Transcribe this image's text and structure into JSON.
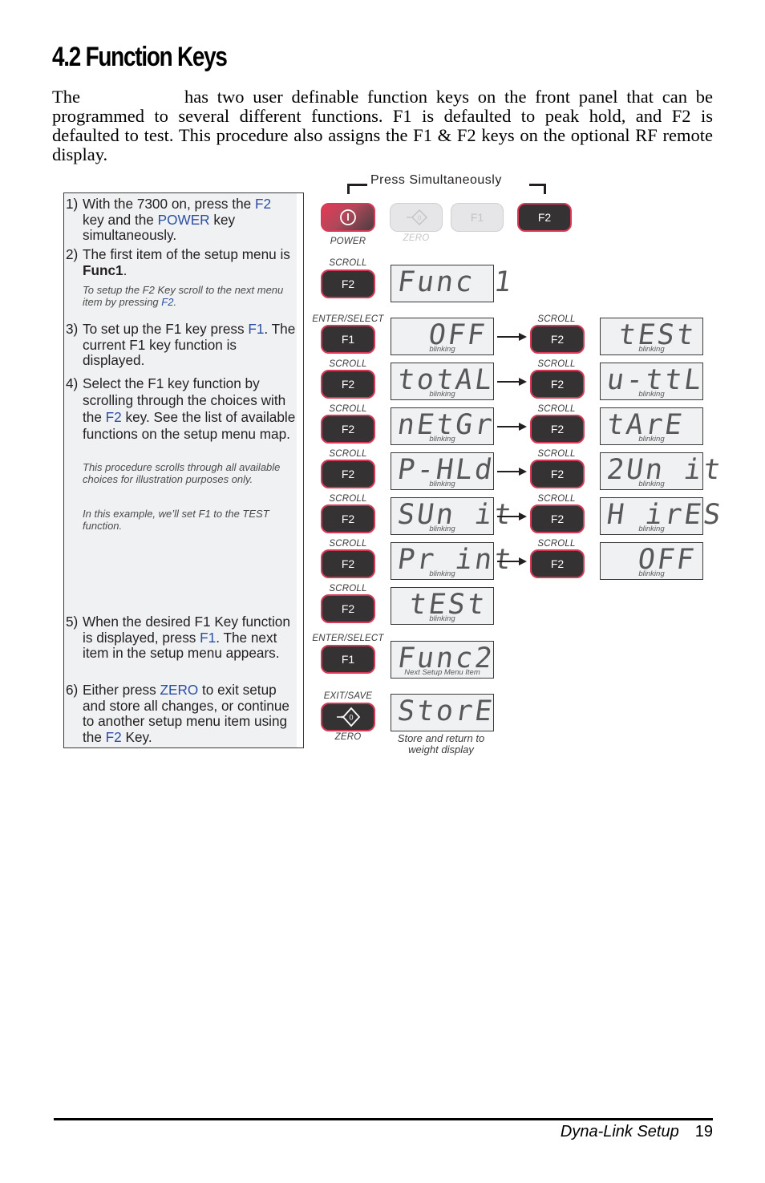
{
  "heading": "4.2   Function Keys",
  "intro": {
    "start": "The",
    "rest": "has two user definable function keys on the front panel that can be programmed to several different functions. F1 is defaulted to peak hold, and F2 is defaulted to test. This procedure also assigns the F1 & F2 keys on the optional RF remote display."
  },
  "steps": [
    {
      "num": "1)",
      "parts": [
        "With the 7300 on, press the ",
        "F2",
        " key and the ",
        "POWER",
        " key simultaneously."
      ]
    },
    {
      "num": "2)",
      "parts": [
        "The first item of the setup menu is ",
        "Func1",
        "."
      ]
    },
    {
      "num": "3)",
      "parts": [
        "To set up the F1 key press ",
        "F1",
        ". The current F1 key function is displayed."
      ]
    },
    {
      "num": "4)",
      "parts": [
        "Select the F1 key function by scrolling through the choices with the ",
        "F2",
        " key. See the list of available functions on the setup menu map."
      ]
    },
    {
      "num": "5)",
      "parts": [
        "When the desired F1 Key function is displayed, press ",
        "F1",
        ". The next item in the setup menu appears."
      ]
    },
    {
      "num": "6)",
      "parts": [
        "Either press ",
        "ZERO",
        " to exit setup and store all changes, or continue to another setup menu item using the ",
        "F2",
        " Key."
      ]
    }
  ],
  "notes": {
    "f2_setup": [
      "To setup the F2 Key scroll to the next menu item by pressing ",
      "F2",
      "."
    ],
    "illustration": "This procedure scrolls through all available choices for illustration purposes only.",
    "example": "In this example, we’ll set F1 to the TEST function."
  },
  "diagram": {
    "press_simultaneously": "Press Simultaneously",
    "top_keys": {
      "power_label": "POWER",
      "zero_label": "ZERO",
      "f1": "F1",
      "f2": "F2",
      "zero_digit": "0"
    },
    "labels": {
      "scroll": "SCROLL",
      "enter_select": "ENTER/SELECT",
      "exit_save": "EXIT/SAVE",
      "zero": "ZERO",
      "f1": "F1",
      "f2": "F2",
      "blinking": "blinking",
      "next_item": "Next Setup Menu Item",
      "store_caption": "Store and return to weight display"
    },
    "displays": {
      "func1": "Func 1",
      "left": [
        "OFF",
        "totAL",
        "nEtGr",
        "P-HLd",
        "SUn it",
        "Pr int",
        "tESt"
      ],
      "right": [
        "tESt",
        "u-ttL",
        "tArE",
        "2Un it",
        "H irES",
        "OFF"
      ],
      "func2": "Func2",
      "store": "StorE"
    }
  },
  "footer": {
    "section": "Dyna-Link Setup",
    "page": "19"
  }
}
